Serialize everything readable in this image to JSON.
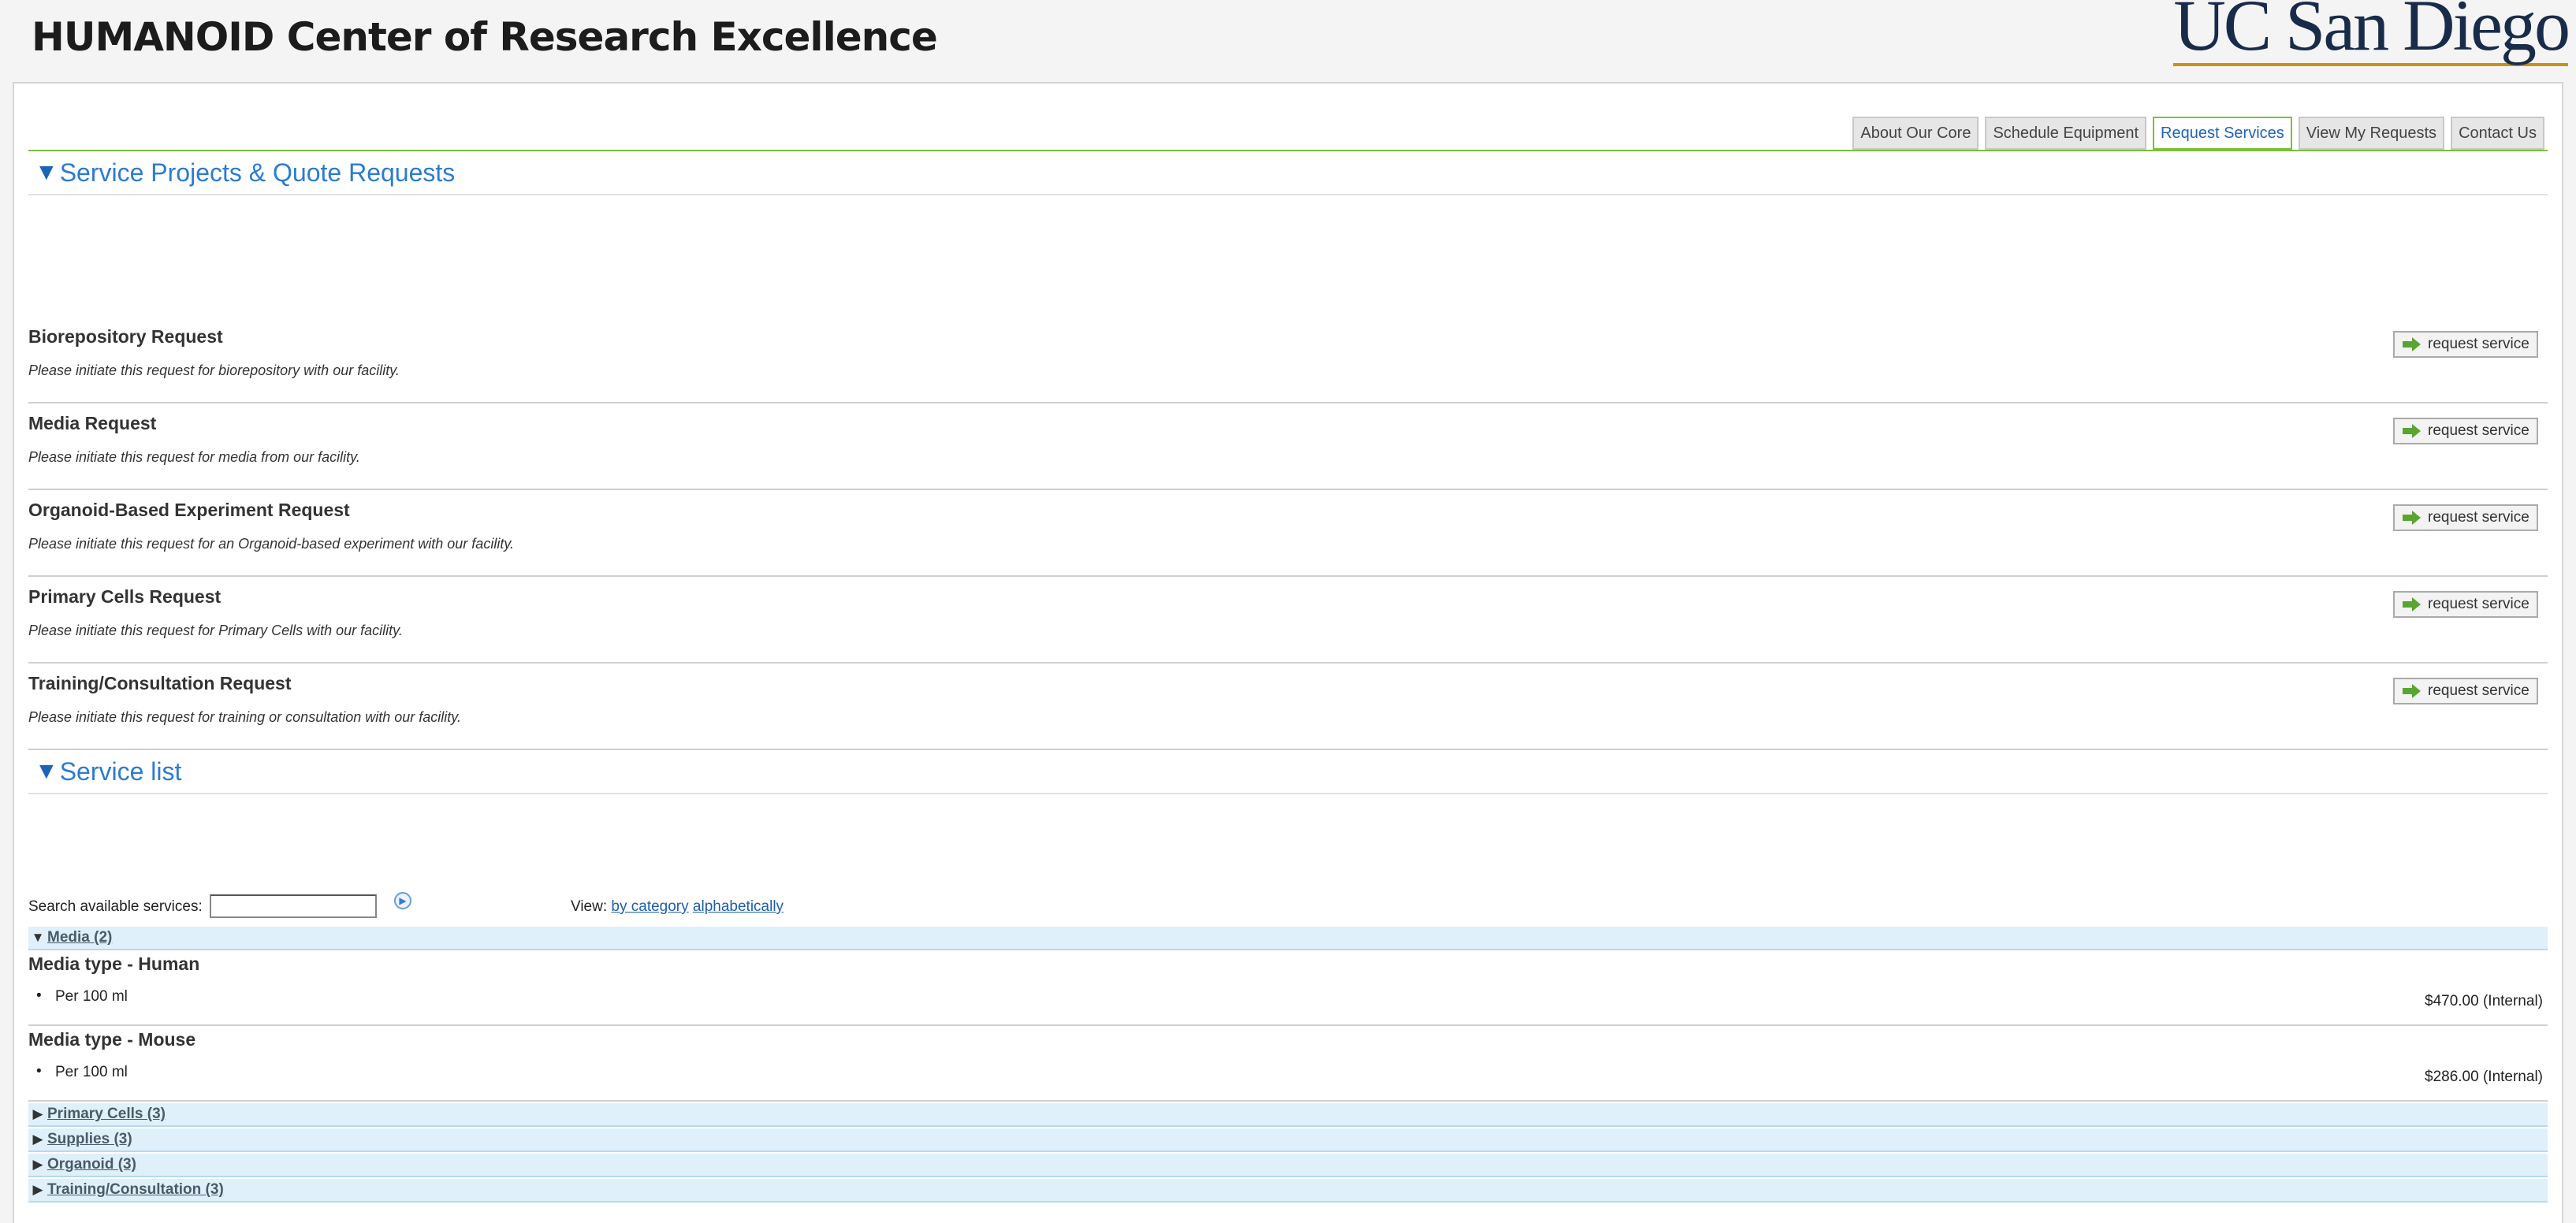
{
  "header": {
    "title": "HUMANOID Center of Research Excellence",
    "logo_text": "UC San Diego"
  },
  "tabs": [
    {
      "label": "About Our Core",
      "active": false
    },
    {
      "label": "Schedule Equipment",
      "active": false
    },
    {
      "label": "Request Services",
      "active": true
    },
    {
      "label": "View My Requests",
      "active": false
    },
    {
      "label": "Contact Us",
      "active": false
    }
  ],
  "sections": {
    "projects": {
      "title": "Service Projects & Quote Requests"
    },
    "service_list": {
      "title": "Service list"
    }
  },
  "service_requests": [
    {
      "name": "Biorepository Request",
      "description": "Please initiate this request for biorepository with our facility.",
      "button": "request service"
    },
    {
      "name": "Media Request",
      "description": "Please initiate this request for media from our facility.",
      "button": "request service"
    },
    {
      "name": "Organoid-Based Experiment Request",
      "description": "Please initiate this request for an Organoid-based experiment with our facility.",
      "button": "request service"
    },
    {
      "name": "Primary Cells Request",
      "description": "Please initiate this request for Primary Cells with our facility.",
      "button": "request service"
    },
    {
      "name": "Training/Consultation Request",
      "description": "Please initiate this request for training or consultation with our facility.",
      "button": "request service"
    }
  ],
  "search": {
    "label": "Search available services:",
    "value": "",
    "view_label": "View:",
    "view_by_category": "by category",
    "view_alphabetically": "alphabetically"
  },
  "categories": [
    {
      "label": "Media (2)",
      "expanded": true
    },
    {
      "label": "Primary Cells (3)",
      "expanded": false
    },
    {
      "label": "Supplies (3)",
      "expanded": false
    },
    {
      "label": "Organoid (3)",
      "expanded": false
    },
    {
      "label": "Training/Consultation (3)",
      "expanded": false
    }
  ],
  "media_items": [
    {
      "name": "Media type - Human",
      "unit": "Per 100 ml",
      "price": "$470.00 (Internal)"
    },
    {
      "name": "Media type - Mouse",
      "unit": "Per 100 ml",
      "price": "$286.00 (Internal)"
    }
  ],
  "glyphs": {
    "expanded": "▼",
    "collapsed": "▶"
  },
  "colors": {
    "accent_green": "#7cbf3c",
    "link_blue": "#2b7bd0",
    "category_bg": "#dff0fb",
    "logo_navy": "#182b49",
    "logo_gold": "#c69214"
  }
}
